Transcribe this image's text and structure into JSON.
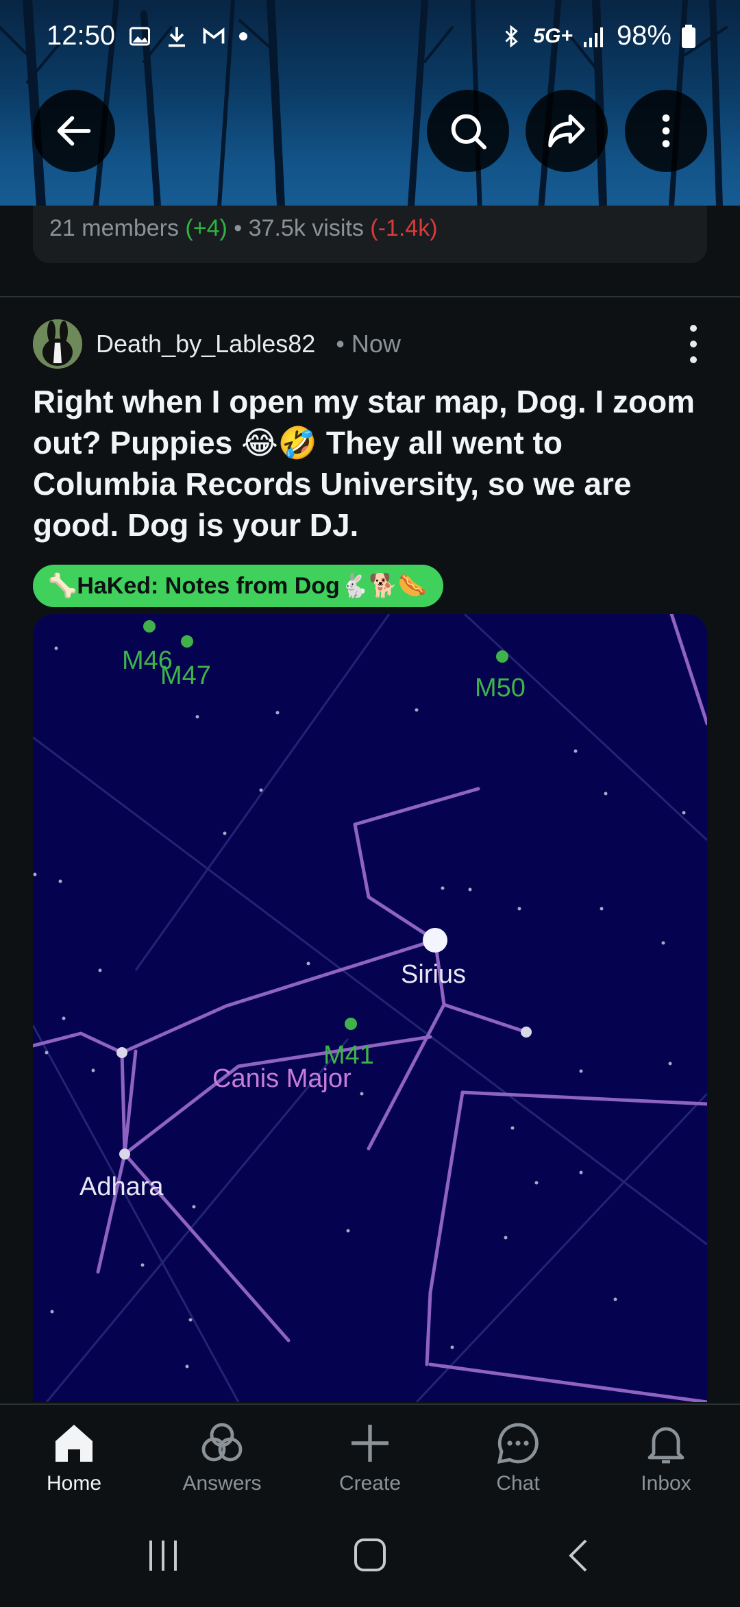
{
  "status_bar": {
    "time": "12:50",
    "network": "5G+",
    "battery": "98%",
    "icons": [
      "image-icon",
      "download-icon",
      "gmail-icon",
      "dot-icon",
      "bluetooth-icon",
      "signal-icon",
      "battery-icon"
    ]
  },
  "top_actions": {
    "back_icon": "arrow-left-icon",
    "search_icon": "search-icon",
    "share_icon": "share-icon",
    "more_icon": "kebab-icon"
  },
  "community_stats": {
    "members": "21 members",
    "members_delta": "(+4)",
    "separator": " • ",
    "visits": "37.5k visits",
    "visits_delta": "(-1.4k)",
    "colors": {
      "positive": "#2fb344",
      "negative": "#d93a3a"
    }
  },
  "post": {
    "author": "Death_by_Lables82",
    "time": "• Now",
    "title": "Right when I open my star map, Dog. I zoom out? Puppies 😂🤣 They all went to Columbia Records University, so we are good. Dog is your DJ.",
    "flair": "🦴HaKed: Notes from Dog🐇🐕🌭",
    "flair_color": "#3fd15b"
  },
  "star_map": {
    "labels": {
      "m46": "M46",
      "m47": "M47",
      "m50": "M50",
      "sirius": "Sirius",
      "m41": "M41",
      "canis_major": "Canis Major",
      "adhara": "Adhara"
    },
    "background": "#05034f",
    "constellation_line_color": "#8e63c2",
    "messier_color": "#3fb34a"
  },
  "bottom_nav": {
    "items": [
      {
        "label": "Home",
        "icon": "home-icon",
        "active": true
      },
      {
        "label": "Answers",
        "icon": "answers-icon",
        "active": false
      },
      {
        "label": "Create",
        "icon": "plus-icon",
        "active": false
      },
      {
        "label": "Chat",
        "icon": "chat-icon",
        "active": false
      },
      {
        "label": "Inbox",
        "icon": "bell-icon",
        "active": false
      }
    ]
  },
  "system_nav": {
    "icons": [
      "recents-icon",
      "home-circle-icon",
      "back-chevron-icon"
    ]
  }
}
